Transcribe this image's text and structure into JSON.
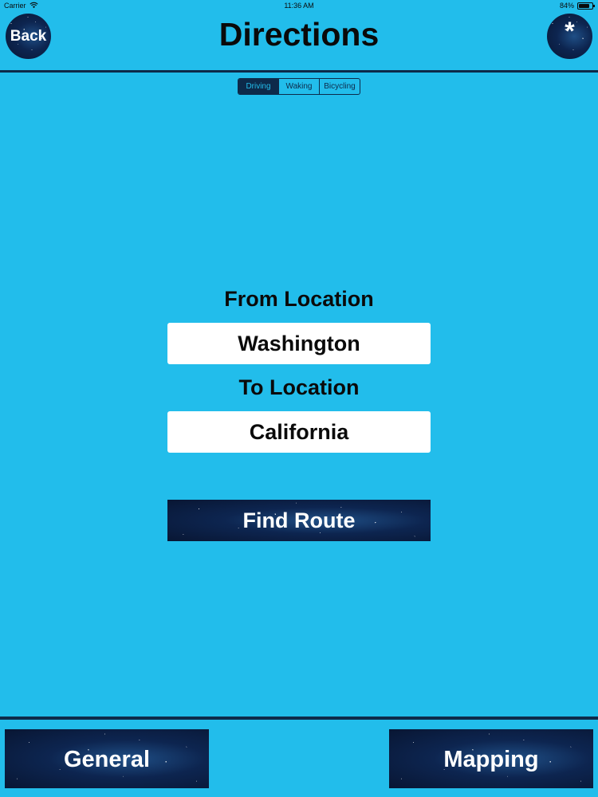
{
  "status_bar": {
    "carrier": "Carrier",
    "time": "11:36 AM",
    "battery_percent": "84%",
    "battery_level": 0.84
  },
  "header": {
    "title": "Directions",
    "back_label": "Back",
    "star_label": "*"
  },
  "travel_modes": {
    "selected": "Driving",
    "options": [
      "Driving",
      "Waking",
      "Bicycling"
    ]
  },
  "form": {
    "from_label": "From Location",
    "from_value": "Washington",
    "to_label": "To Location",
    "to_value": "California",
    "submit_label": "Find Route"
  },
  "bottom_nav": {
    "general_label": "General",
    "mapping_label": "Mapping"
  },
  "colors": {
    "background": "#22bdeb",
    "dark_navy": "#0d2a4a",
    "input_background": "#ffffff",
    "button_text": "#ffffff"
  },
  "icons": {
    "wifi": "wifi-icon",
    "battery": "battery-icon",
    "button_texture": "starfield-texture"
  }
}
